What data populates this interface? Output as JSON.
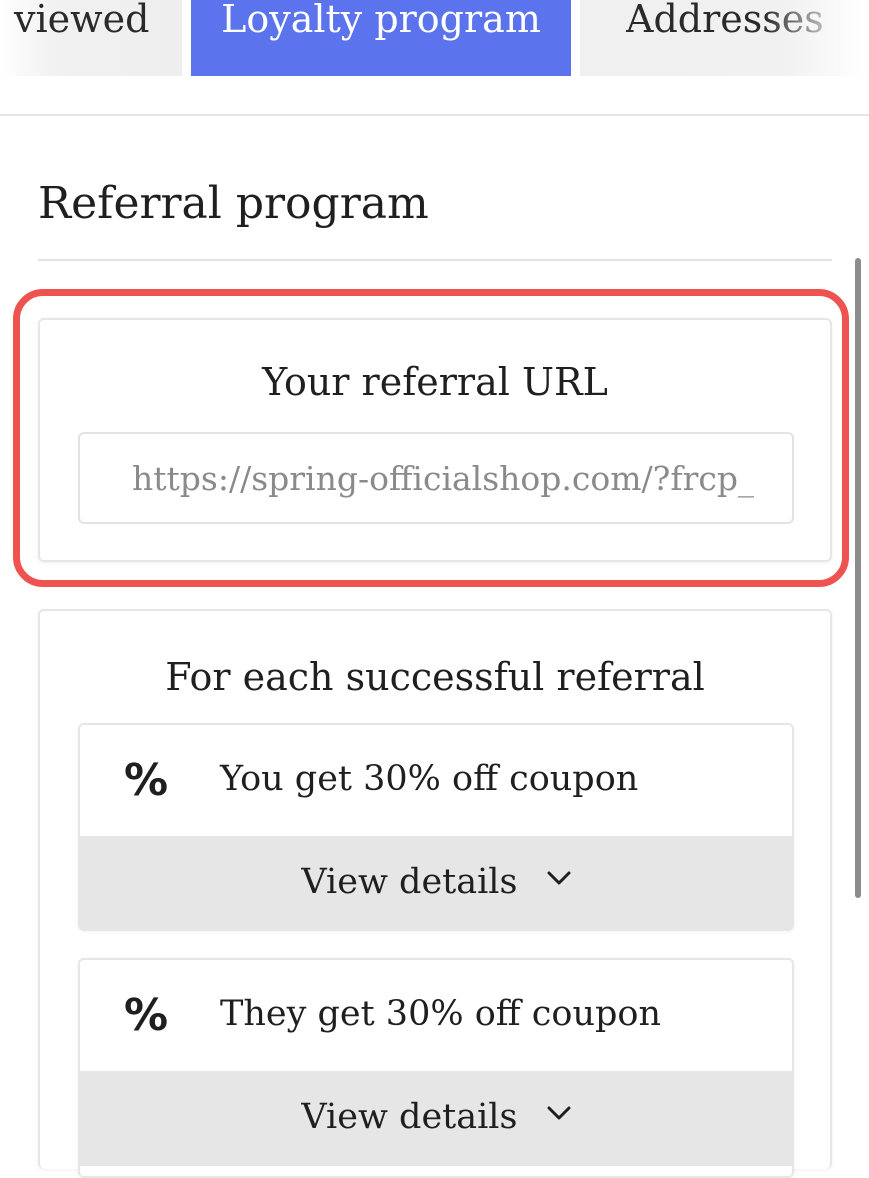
{
  "tabs": [
    {
      "label": "viewed"
    },
    {
      "label": "Loyalty program"
    },
    {
      "label": "Addresses"
    }
  ],
  "colors": {
    "active_tab": "#5b74ee",
    "highlight": "#ef5350",
    "details_bg": "#e6e6e6"
  },
  "section": {
    "title": "Referral program"
  },
  "referral_url": {
    "title": "Your referral URL",
    "value": "https://spring-officialshop.com/?frcp_"
  },
  "benefits": {
    "title": "For each successful referral",
    "items": [
      {
        "icon": "percent-icon",
        "text": "You get 30% off coupon",
        "details_label": "View details"
      },
      {
        "icon": "percent-icon",
        "text": "They get 30% off coupon",
        "details_label": "View details"
      }
    ]
  }
}
